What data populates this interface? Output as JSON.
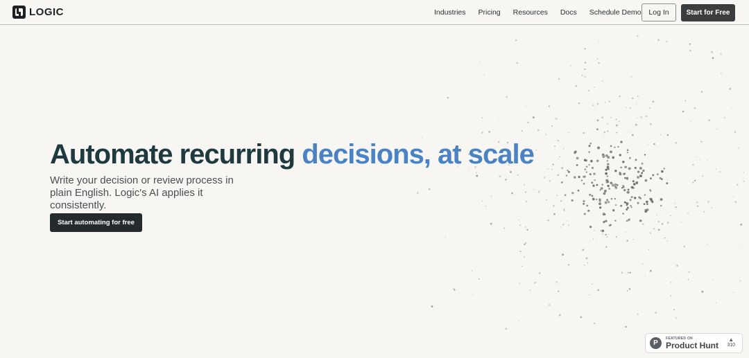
{
  "brand": {
    "name": "LOGIC"
  },
  "nav": {
    "links": [
      "Industries",
      "Pricing",
      "Resources",
      "Docs",
      "Schedule Demo"
    ],
    "login_label": "Log In",
    "start_label": "Start for Free"
  },
  "hero": {
    "title_part1": "Automate recurring",
    "title_part2": "decisions, at scale",
    "subtitle": "Write your decision or review process in plain English. Logic's AI applies it consistently.",
    "cta_label": "Start automating for free"
  },
  "product_hunt": {
    "featured_label": "FEATURED ON",
    "name": "Product Hunt",
    "letter": "P",
    "votes": "310"
  },
  "colors": {
    "title_dark": "#1e3a3f",
    "title_accent": "#4a82c4",
    "background": "#f7f6f2",
    "button_dark": "#252a2d"
  },
  "icons": [
    "logo-mark-icon",
    "upvote-arrow-icon",
    "product-hunt-logo-icon"
  ]
}
